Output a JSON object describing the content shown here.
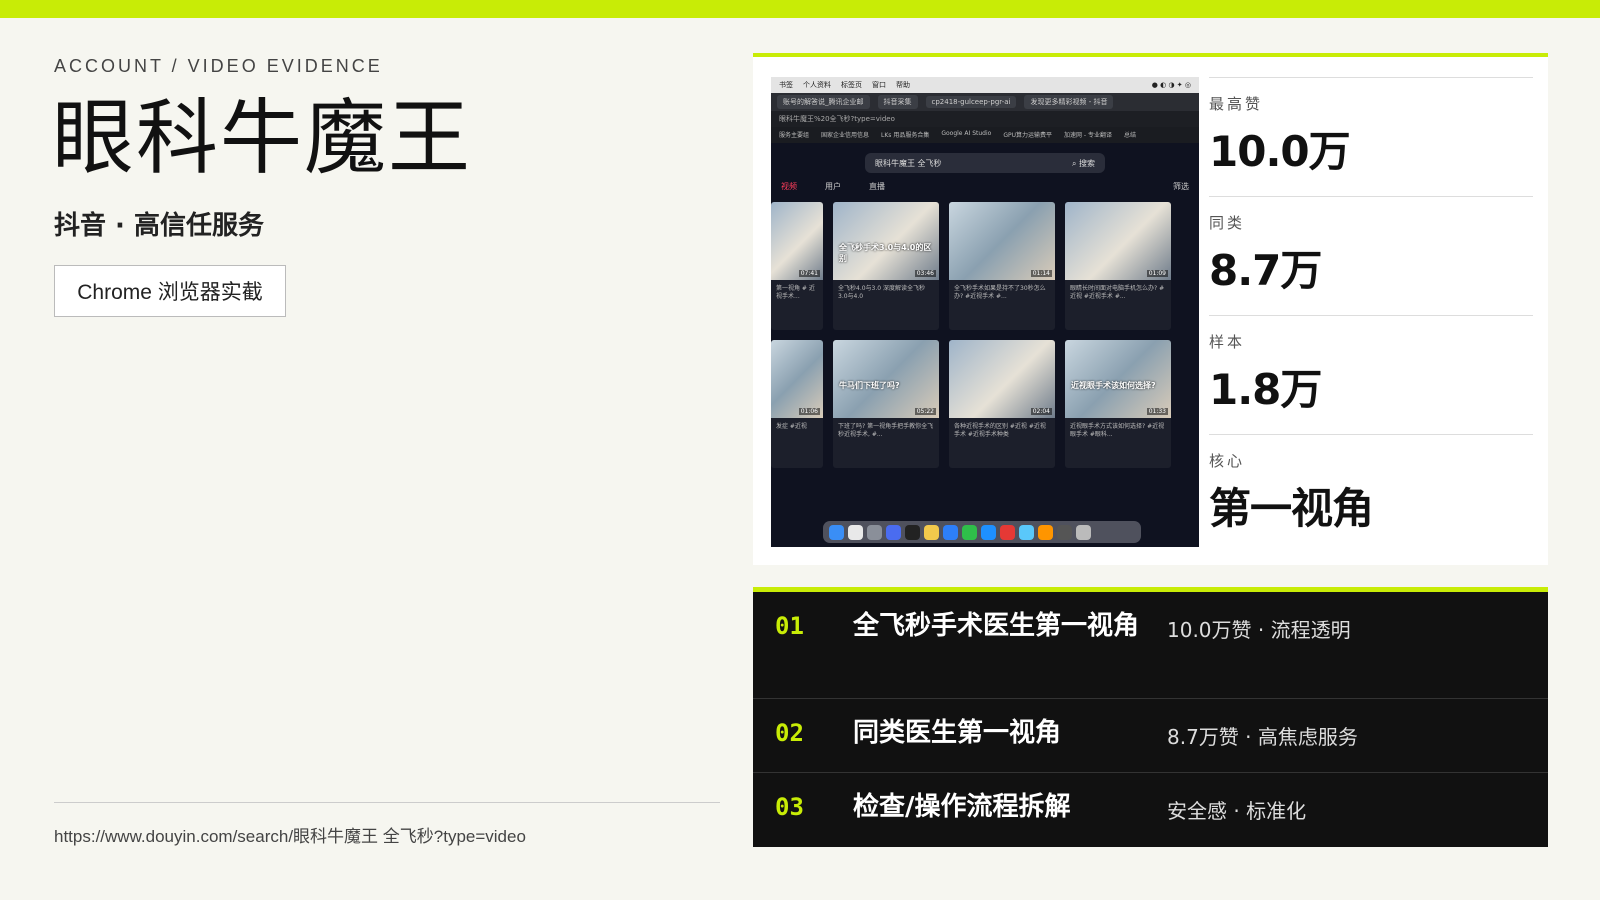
{
  "eyebrow": "ACCOUNT / VIDEO EVIDENCE",
  "title": "眼科牛魔王",
  "subtitle": "抖音 · 高信任服务",
  "tag": "Chrome 浏览器实截",
  "url": "https://www.douyin.com/search/眼科牛魔王 全飞秒?type=video",
  "colors": {
    "accent": "#c8ec06",
    "background": "#f6f6f0",
    "dark": "#111111"
  },
  "screenshot": {
    "menubar": [
      "书签",
      "个人资料",
      "标签页",
      "窗口",
      "帮助"
    ],
    "tabs": [
      "账号的解答说_腾讯企业邮",
      "抖音采集",
      "cp2418-gulceep-pgr-ai",
      "发现更多精彩视频 - 抖音"
    ],
    "address": "眼科牛魔王%20全飞秒?type=video",
    "bookmarks": [
      "服务主要组",
      "国家企业信用信息",
      "LKs 用品服务合集",
      "Google AI Studio",
      "GPU算力运输费平",
      "加速网 - 专业翻译",
      "总结"
    ],
    "search_text": "眼科牛魔王 全飞秒",
    "search_button": "搜索",
    "dy_tabs": [
      "视频",
      "用户",
      "直播"
    ],
    "filter": "筛选",
    "videos": [
      {
        "overlay": "",
        "duration": "07:41",
        "caption": "第一视角 # 近视手术..."
      },
      {
        "overlay": "全飞秒手术3.0与4.0的区别",
        "duration": "03:46",
        "caption": "全飞秒4.0与3.0 深度解读全飞秒3.0与4.0"
      },
      {
        "overlay": "",
        "duration": "01:14",
        "caption": "全飞秒手术如果是持不了30秒怎么办? #近视手术 #..."
      },
      {
        "overlay": "",
        "duration": "01:09",
        "caption": "眼睛长时间面对电脑手机怎么办? #近视 #近视手术 #..."
      },
      {
        "overlay": "",
        "duration": "01:06",
        "caption": "发症 #近视"
      },
      {
        "overlay": "牛马们下班了吗?",
        "duration": "05:22",
        "caption": "下班了吗? 第一视角手把手教你全飞秒近视手术, #..."
      },
      {
        "overlay": "",
        "duration": "02:04",
        "caption": "各种近视手术的区别 #近视 #近视手术 #近视手术种类"
      },
      {
        "overlay": "近视眼手术该如何选择?",
        "duration": "01:33",
        "caption": "近视眼手术方式该如何选择? #近视眼手术 #眼科..."
      }
    ]
  },
  "metrics": [
    {
      "label": "最高赞",
      "value": "10.0万"
    },
    {
      "label": "同类",
      "value": "8.7万"
    },
    {
      "label": "样本",
      "value": "1.8万"
    },
    {
      "label": "核心",
      "value": "第一视角"
    }
  ],
  "list": [
    {
      "num": "01",
      "name": "全飞秒手术医生第一视角",
      "meta": "10.0万赞 · 流程透明"
    },
    {
      "num": "02",
      "name": "同类医生第一视角",
      "meta": "8.7万赞 · 高焦虑服务"
    },
    {
      "num": "03",
      "name": "检查/操作流程拆解",
      "meta": "安全感 · 标准化"
    }
  ]
}
